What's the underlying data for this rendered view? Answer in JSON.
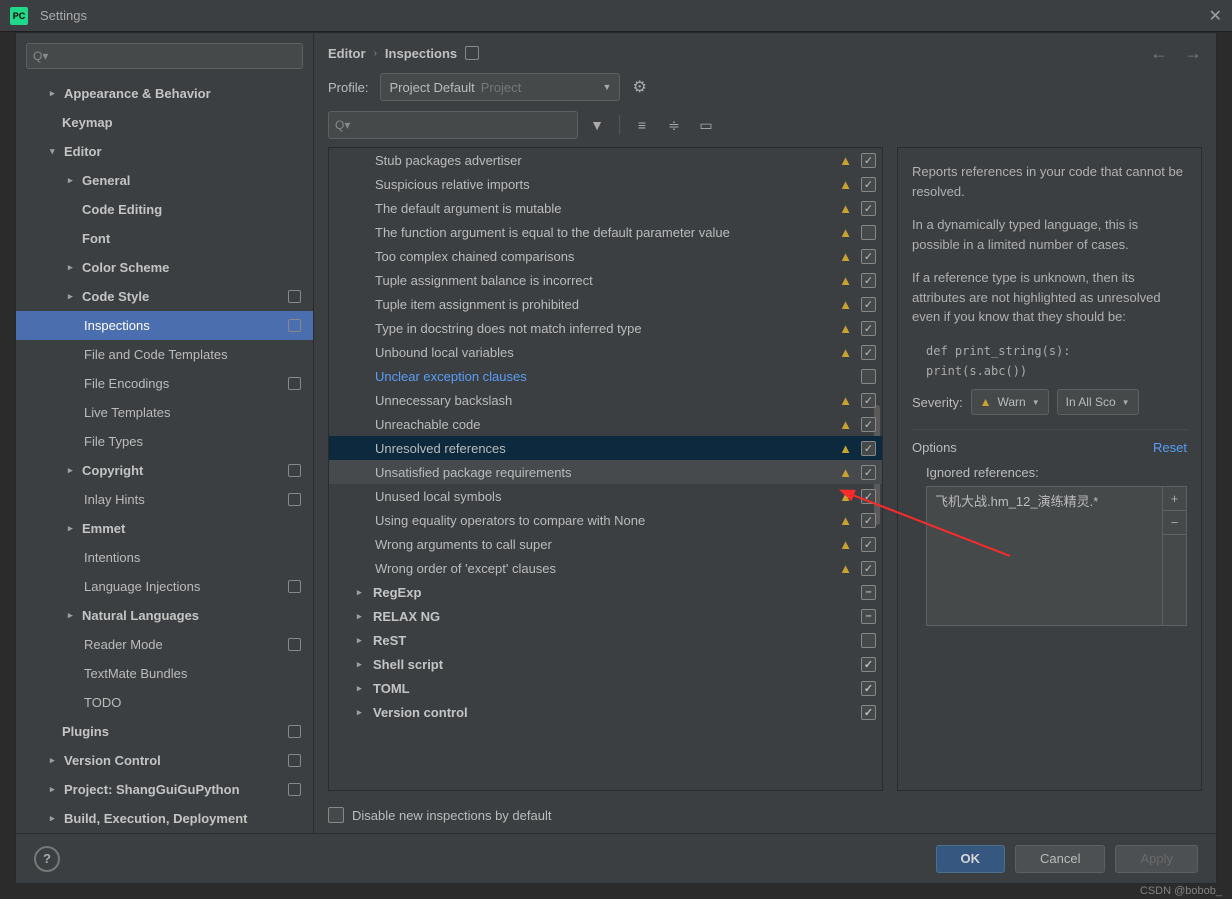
{
  "window": {
    "title": "Settings"
  },
  "breadcrumb": {
    "a": "Editor",
    "b": "Inspections"
  },
  "profile": {
    "label": "Profile:",
    "selected": "Project Default",
    "hint": "Project"
  },
  "sidebar": {
    "items": [
      {
        "label": "Appearance & Behavior",
        "type": "l1",
        "caret": ">",
        "badge": false
      },
      {
        "label": "Keymap",
        "type": "l1 nocaret",
        "badge": false
      },
      {
        "label": "Editor",
        "type": "l1",
        "caret": "v",
        "badge": false
      },
      {
        "label": "General",
        "type": "l2",
        "caret": ">",
        "badge": false
      },
      {
        "label": "Code Editing",
        "type": "l2 nocaret",
        "badge": false
      },
      {
        "label": "Font",
        "type": "l2 nocaret",
        "badge": false
      },
      {
        "label": "Color Scheme",
        "type": "l2",
        "caret": ">",
        "badge": false
      },
      {
        "label": "Code Style",
        "type": "l2",
        "caret": ">",
        "badge": true
      },
      {
        "label": "Inspections",
        "type": "l3",
        "selected": true,
        "badge": true
      },
      {
        "label": "File and Code Templates",
        "type": "l3",
        "badge": false
      },
      {
        "label": "File Encodings",
        "type": "l3",
        "badge": true
      },
      {
        "label": "Live Templates",
        "type": "l3",
        "badge": false
      },
      {
        "label": "File Types",
        "type": "l3",
        "badge": false
      },
      {
        "label": "Copyright",
        "type": "l2",
        "caret": ">",
        "badge": true
      },
      {
        "label": "Inlay Hints",
        "type": "l3",
        "badge": true
      },
      {
        "label": "Emmet",
        "type": "l2",
        "caret": ">",
        "badge": false
      },
      {
        "label": "Intentions",
        "type": "l3",
        "badge": false
      },
      {
        "label": "Language Injections",
        "type": "l3",
        "badge": true
      },
      {
        "label": "Natural Languages",
        "type": "l2",
        "caret": ">",
        "badge": false
      },
      {
        "label": "Reader Mode",
        "type": "l3",
        "badge": true
      },
      {
        "label": "TextMate Bundles",
        "type": "l3",
        "badge": false
      },
      {
        "label": "TODO",
        "type": "l3",
        "badge": false
      },
      {
        "label": "Plugins",
        "type": "l1 nocaret",
        "badge": true
      },
      {
        "label": "Version Control",
        "type": "l1",
        "caret": ">",
        "badge": true
      },
      {
        "label": "Project: ShangGuiGuPython",
        "type": "l1",
        "caret": ">",
        "badge": true
      },
      {
        "label": "Build, Execution, Deployment",
        "type": "l1",
        "caret": ">",
        "badge": false
      }
    ]
  },
  "inspections": {
    "items": [
      {
        "label": "Stub packages advertiser",
        "warn": true,
        "chk": "on"
      },
      {
        "label": "Suspicious relative imports",
        "warn": true,
        "chk": "on"
      },
      {
        "label": "The default argument is mutable",
        "warn": true,
        "chk": "on"
      },
      {
        "label": "The function argument is equal to the default parameter value",
        "warn": true,
        "chk": "off"
      },
      {
        "label": "Too complex chained comparisons",
        "warn": true,
        "chk": "on"
      },
      {
        "label": "Tuple assignment balance is incorrect",
        "warn": true,
        "chk": "on"
      },
      {
        "label": "Tuple item assignment is prohibited",
        "warn": true,
        "chk": "on"
      },
      {
        "label": "Type in docstring does not match inferred type",
        "warn": true,
        "chk": "on"
      },
      {
        "label": "Unbound local variables",
        "warn": true,
        "chk": "on"
      },
      {
        "label": "Unclear exception clauses",
        "warn": false,
        "chk": "off",
        "link": true
      },
      {
        "label": "Unnecessary backslash",
        "warn": true,
        "chk": "on"
      },
      {
        "label": "Unreachable code",
        "warn": true,
        "chk": "on"
      },
      {
        "label": "Unresolved references",
        "warn": true,
        "chk": "on",
        "selected": true
      },
      {
        "label": "Unsatisfied package requirements",
        "warn": true,
        "chk": "on",
        "hover": true
      },
      {
        "label": "Unused local symbols",
        "warn": true,
        "chk": "on"
      },
      {
        "label": "Using equality operators to compare with None",
        "warn": true,
        "chk": "on"
      },
      {
        "label": "Wrong arguments to call super",
        "warn": true,
        "chk": "on"
      },
      {
        "label": "Wrong order of 'except' clauses",
        "warn": true,
        "chk": "on"
      }
    ],
    "groups": [
      {
        "label": "RegExp",
        "chk": "mixed"
      },
      {
        "label": "RELAX NG",
        "chk": "mixed"
      },
      {
        "label": "ReST",
        "chk": "off"
      },
      {
        "label": "Shell script",
        "chk": "on"
      },
      {
        "label": "TOML",
        "chk": "on"
      },
      {
        "label": "Version control",
        "chk": "on"
      }
    ],
    "disable_label": "Disable new inspections by default"
  },
  "desc": {
    "p1": "Reports references in your code that cannot be resolved.",
    "p2": "In a dynamically typed language, this is possible in a limited number of cases.",
    "p3": "If a reference type is unknown, then its attributes are not highlighted as unresolved even if you know that they should be:",
    "code1": "def print_string(s):",
    "code2": "  print(s.abc())",
    "severity_label": "Severity:",
    "severity_value": "Warn",
    "scope_value": "In All Sco",
    "options_title": "Options",
    "reset": "Reset",
    "ignored_label": "Ignored references:",
    "ignored_entry": "飞机大战.hm_12_演练精灵.*"
  },
  "buttons": {
    "ok": "OK",
    "cancel": "Cancel",
    "apply": "Apply"
  },
  "watermark": "CSDN @bobob_"
}
